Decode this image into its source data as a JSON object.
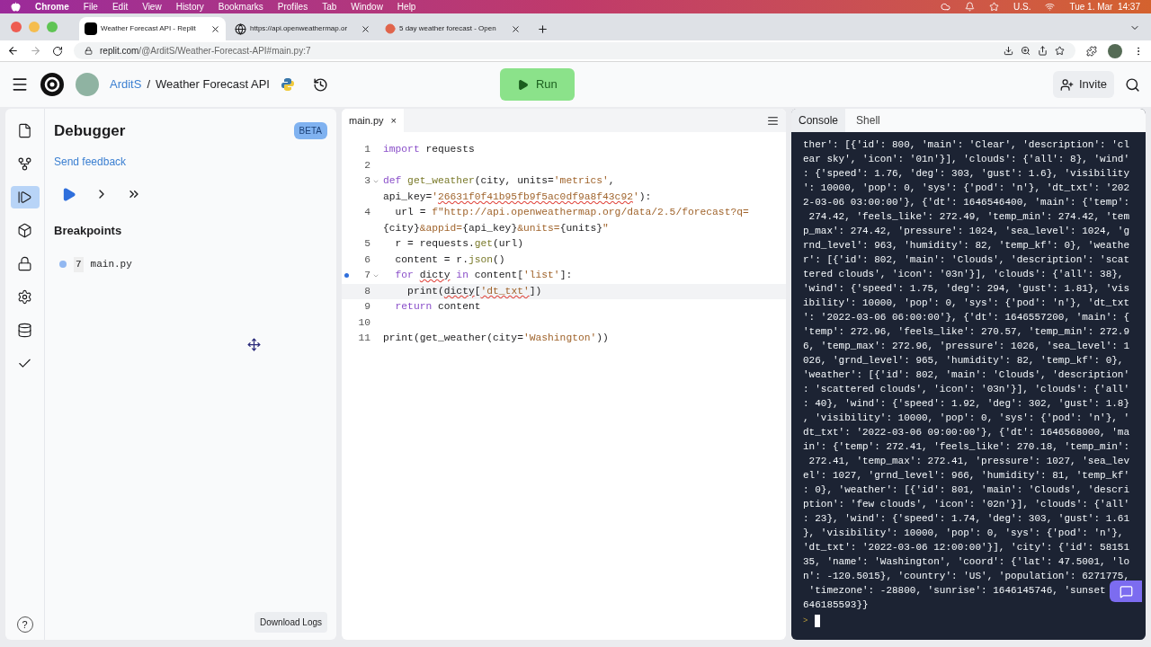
{
  "menubar": {
    "app": "Chrome",
    "items": [
      "File",
      "Edit",
      "View",
      "History",
      "Bookmarks",
      "Profiles",
      "Tab",
      "Window",
      "Help"
    ],
    "input_source": "U.S.",
    "clock": "Tue 1. Mar  14:37"
  },
  "browser": {
    "tabs": [
      {
        "title": "Weather Forecast API - Replit",
        "selected": true,
        "kind": "replit"
      },
      {
        "title": "https://api.openweathermap.or",
        "selected": false,
        "kind": "globe"
      },
      {
        "title": "5 day weather forecast - Open",
        "selected": false,
        "kind": "weather"
      }
    ],
    "url_host": "replit.com",
    "url_path": "/@ArditS/Weather-Forecast-API#main.py:7"
  },
  "header": {
    "user": "ArditS",
    "separator": "/",
    "repl": "Weather Forecast API",
    "run": "Run",
    "invite": "Invite"
  },
  "sidebar": {
    "items": [
      {
        "kind": "file",
        "selected": false
      },
      {
        "kind": "git",
        "selected": false
      },
      {
        "kind": "debugger",
        "selected": true
      },
      {
        "kind": "packages",
        "selected": false
      },
      {
        "kind": "secrets",
        "selected": false
      },
      {
        "kind": "settings",
        "selected": false
      },
      {
        "kind": "database",
        "selected": false
      },
      {
        "kind": "tests",
        "selected": false
      }
    ]
  },
  "debugger": {
    "title": "Debugger",
    "badge": "BETA",
    "feedback": "Send feedback",
    "breakpoints_title": "Breakpoints",
    "breakpoints": [
      {
        "line": "7",
        "file": "main.py"
      }
    ],
    "download": "Download Logs",
    "help": "?"
  },
  "editor": {
    "tab": "main.py",
    "close": "×",
    "lines": [
      {
        "number": "1",
        "tokens": [
          {
            "kind": "keyword",
            "t": "import"
          },
          {
            "kind": "plain",
            "t": " requests"
          }
        ]
      },
      {
        "number": "2"
      },
      {
        "number": "3",
        "fold": true,
        "tokens": [
          {
            "kind": "keyword",
            "t": "def"
          },
          {
            "kind": "function",
            "t": " get_weather"
          },
          {
            "kind": "plain",
            "t": "(city, units="
          },
          {
            "kind": "string",
            "t": "'metrics'"
          },
          {
            "kind": "plain",
            "t": ","
          }
        ]
      },
      {
        "tokens": [
          {
            "kind": "plain",
            "t": "api_key="
          },
          {
            "kind": "string",
            "t": "'"
          },
          {
            "kind": "string",
            "t": "26631f0f41b95fb9f5ac0df9a8f43c92",
            "squiggle": true
          },
          {
            "kind": "string",
            "t": "'"
          },
          {
            "kind": "plain",
            "t": "):"
          }
        ]
      },
      {
        "number": "4",
        "tokens": [
          {
            "kind": "plain",
            "t": "  url = "
          },
          {
            "kind": "string",
            "t": "f\"http://api.openweathermap.org/data/2.5/forecast?q="
          }
        ]
      },
      {
        "tokens": [
          {
            "kind": "plain",
            "t": "{city}"
          },
          {
            "kind": "string",
            "t": "&appid="
          },
          {
            "kind": "plain",
            "t": "{api_key}"
          },
          {
            "kind": "string",
            "t": "&units="
          },
          {
            "kind": "plain",
            "t": "{units}"
          },
          {
            "kind": "string",
            "t": "\""
          }
        ]
      },
      {
        "number": "5",
        "tokens": [
          {
            "kind": "plain",
            "t": "  r = requests."
          },
          {
            "kind": "function",
            "t": "get"
          },
          {
            "kind": "plain",
            "t": "(url)"
          }
        ]
      },
      {
        "number": "6",
        "tokens": [
          {
            "kind": "plain",
            "t": "  content = r."
          },
          {
            "kind": "function",
            "t": "json"
          },
          {
            "kind": "plain",
            "t": "()"
          }
        ]
      },
      {
        "number": "7",
        "fold": true,
        "breakpoint": true,
        "tokens": [
          {
            "kind": "keyword",
            "t": "  for "
          },
          {
            "kind": "plain",
            "t": "dicty",
            "squiggle": true
          },
          {
            "kind": "keyword",
            "t": " in"
          },
          {
            "kind": "plain",
            "t": " content["
          },
          {
            "kind": "string",
            "t": "'list'"
          },
          {
            "kind": "plain",
            "t": "]:"
          }
        ]
      },
      {
        "number": "8",
        "current": true,
        "tokens": [
          {
            "kind": "plain",
            "t": "    print("
          },
          {
            "kind": "plain",
            "t": "dicty",
            "squiggle": true
          },
          {
            "kind": "plain",
            "t": "["
          },
          {
            "kind": "string",
            "t": "'dt_txt'",
            "squiggle": true
          },
          {
            "kind": "plain",
            "t": "])"
          }
        ]
      },
      {
        "number": "9",
        "tokens": [
          {
            "kind": "keyword",
            "t": "  return"
          },
          {
            "kind": "plain",
            "t": " content"
          }
        ]
      },
      {
        "number": "10"
      },
      {
        "number": "11",
        "tokens": [
          {
            "kind": "plain",
            "t": "print(get_weather(city="
          },
          {
            "kind": "string",
            "t": "'Washington'"
          },
          {
            "kind": "plain",
            "t": "))"
          }
        ]
      }
    ]
  },
  "console": {
    "tabs": [
      {
        "label": "Console",
        "selected": true
      },
      {
        "label": "Shell",
        "selected": false
      }
    ],
    "prompt": ">",
    "lines": [
      "ther': [{'id': 800, 'main': 'Clear', 'description': 'cl",
      "ear sky', 'icon': '01n'}], 'clouds': {'all': 8}, 'wind'",
      ": {'speed': 1.76, 'deg': 303, 'gust': 1.6}, 'visibility",
      "': 10000, 'pop': 0, 'sys': {'pod': 'n'}, 'dt_txt': '202",
      "2-03-06 03:00:00'}, {'dt': 1646546400, 'main': {'temp':",
      " 274.42, 'feels_like': 272.49, 'temp_min': 274.42, 'tem",
      "p_max': 274.42, 'pressure': 1024, 'sea_level': 1024, 'g",
      "rnd_level': 963, 'humidity': 82, 'temp_kf': 0}, 'weathe",
      "r': [{'id': 802, 'main': 'Clouds', 'description': 'scat",
      "tered clouds', 'icon': '03n'}], 'clouds': {'all': 38},",
      "'wind': {'speed': 1.75, 'deg': 294, 'gust': 1.81}, 'vis",
      "ibility': 10000, 'pop': 0, 'sys': {'pod': 'n'}, 'dt_txt",
      "': '2022-03-06 06:00:00'}, {'dt': 1646557200, 'main': {",
      "'temp': 272.96, 'feels_like': 270.57, 'temp_min': 272.9",
      "6, 'temp_max': 272.96, 'pressure': 1026, 'sea_level': 1",
      "026, 'grnd_level': 965, 'humidity': 82, 'temp_kf': 0},",
      "'weather': [{'id': 802, 'main': 'Clouds', 'description'",
      ": 'scattered clouds', 'icon': '03n'}], 'clouds': {'all'",
      ": 40}, 'wind': {'speed': 1.92, 'deg': 302, 'gust': 1.8}",
      ", 'visibility': 10000, 'pop': 0, 'sys': {'pod': 'n'}, '",
      "dt_txt': '2022-03-06 09:00:00'}, {'dt': 1646568000, 'ma",
      "in': {'temp': 272.41, 'feels_like': 270.18, 'temp_min':",
      " 272.41, 'temp_max': 272.41, 'pressure': 1027, 'sea_lev",
      "el': 1027, 'grnd_level': 966, 'humidity': 81, 'temp_kf'",
      ": 0}, 'weather': [{'id': 801, 'main': 'Clouds', 'descri",
      "ption': 'few clouds', 'icon': '02n'}], 'clouds': {'all'",
      ": 23}, 'wind': {'speed': 1.74, 'deg': 303, 'gust': 1.61",
      "}, 'visibility': 10000, 'pop': 0, 'sys': {'pod': 'n'},",
      "'dt_txt': '2022-03-06 12:00:00'}], 'city': {'id': 58151",
      "35, 'name': 'Washington', 'coord': {'lat': 47.5001, 'lo",
      "n': -120.5015}, 'country': 'US', 'population': 6271775,",
      " 'timezone': -28800, 'sunrise': 1646145746, 'sunset",
      "646185593}}"
    ]
  }
}
